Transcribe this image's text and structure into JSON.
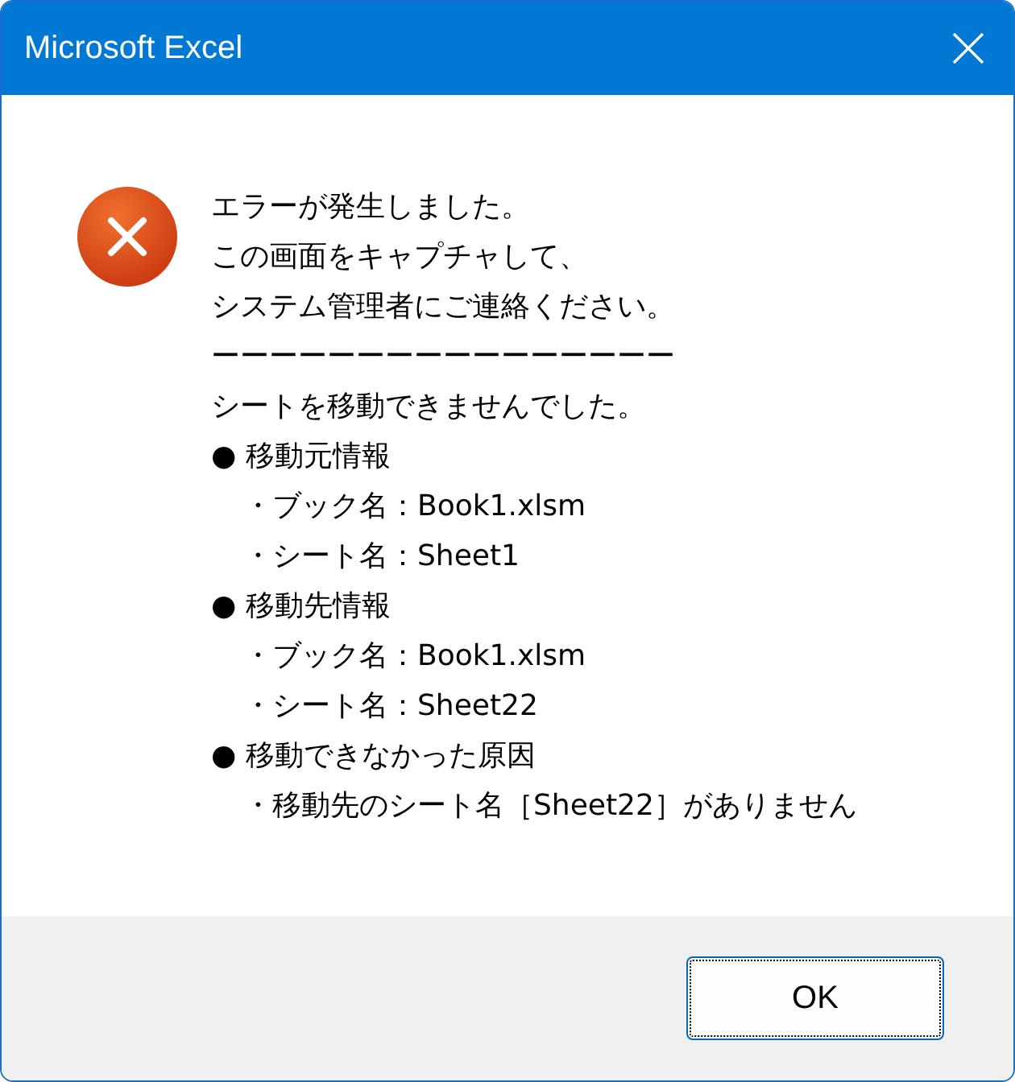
{
  "window": {
    "title": "Microsoft Excel"
  },
  "message": [
    {
      "kind": "text",
      "text": "エラーが発生しました。"
    },
    {
      "kind": "text",
      "text": "この画面をキャプチャして、"
    },
    {
      "kind": "text",
      "text": "システム管理者にご連絡ください。"
    },
    {
      "kind": "text",
      "text": "ーーーーーーーーーーーーーーーー"
    },
    {
      "kind": "text",
      "text": "シートを移動できませんでした。"
    },
    {
      "kind": "bullet",
      "text": "● 移動元情報"
    },
    {
      "kind": "sub",
      "text": "・ブック名：Book1.xlsm"
    },
    {
      "kind": "sub",
      "text": "・シート名：Sheet1"
    },
    {
      "kind": "bullet",
      "text": "● 移動先情報"
    },
    {
      "kind": "sub",
      "text": "・ブック名：Book1.xlsm"
    },
    {
      "kind": "sub",
      "text": "・シート名：Sheet22"
    },
    {
      "kind": "bullet",
      "text": "● 移動できなかった原因"
    },
    {
      "kind": "sub",
      "text": "・移動先のシート名［Sheet22］がありません"
    }
  ],
  "buttons": [
    {
      "label": "OK"
    }
  ]
}
